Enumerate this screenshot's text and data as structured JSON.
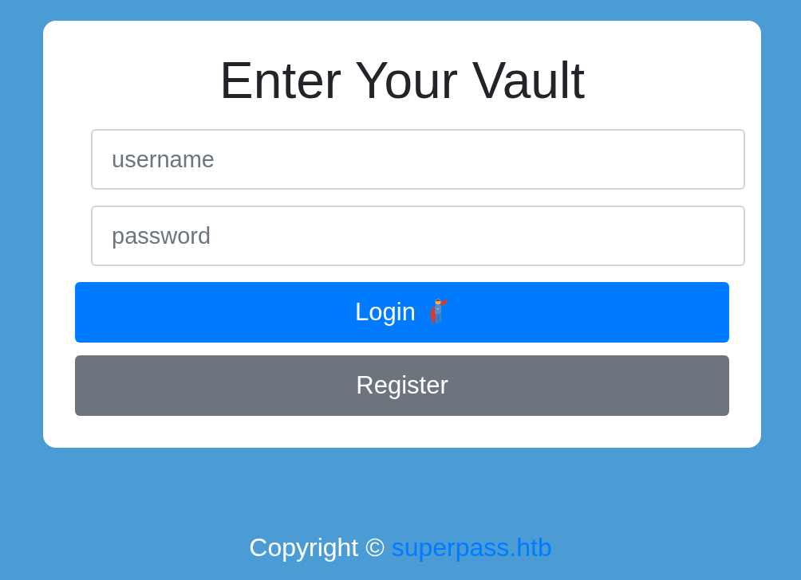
{
  "card": {
    "title": "Enter Your Vault",
    "fields": [
      {
        "placeholder": "username"
      },
      {
        "placeholder": "password"
      }
    ],
    "buttons": [
      {
        "label": "Login",
        "kind": "primary"
      },
      {
        "label": "Register",
        "kind": "secondary"
      }
    ]
  },
  "footer": {
    "text": "Copyright ©",
    "link": "superpass.htb"
  }
}
